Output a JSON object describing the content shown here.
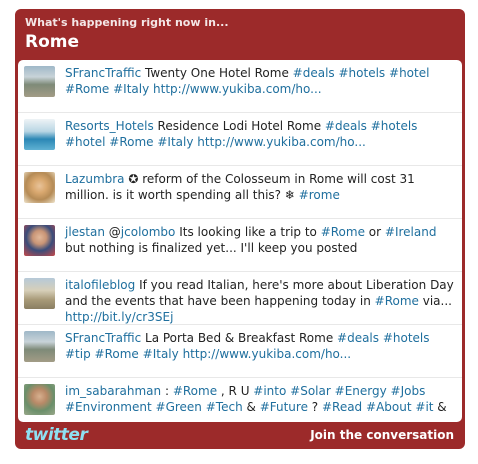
{
  "header": {
    "subtitle": "What's happening right now in...",
    "title": "Rome"
  },
  "colors": {
    "frame": "#9c2a2a",
    "link": "#1f6f9e",
    "logo": "#8ee0f2"
  },
  "tweets": [
    {
      "user": "SFrancTraffic",
      "parts": [
        {
          "t": " Twenty One Hotel Rome "
        },
        {
          "t": "#deals",
          "link": true
        },
        {
          "t": " "
        },
        {
          "t": "#hotels",
          "link": true
        },
        {
          "t": " "
        },
        {
          "t": "#hotel",
          "link": true
        },
        {
          "t": " "
        },
        {
          "t": "#Rome",
          "link": true
        },
        {
          "t": " "
        },
        {
          "t": "#Italy",
          "link": true
        },
        {
          "t": " "
        },
        {
          "t": "http://www.yukiba.com/ho...",
          "link": true
        }
      ],
      "avatar": "city-aerial"
    },
    {
      "user": "Resorts_Hotels",
      "parts": [
        {
          "t": " Residence Lodi Hotel Rome "
        },
        {
          "t": "#deals",
          "link": true
        },
        {
          "t": " "
        },
        {
          "t": "#hotels",
          "link": true
        },
        {
          "t": " "
        },
        {
          "t": "#hotel",
          "link": true
        },
        {
          "t": " "
        },
        {
          "t": "#Rome",
          "link": true
        },
        {
          "t": " "
        },
        {
          "t": "#Italy",
          "link": true
        },
        {
          "t": " "
        },
        {
          "t": "http://www.yukiba.com/ho...",
          "link": true
        }
      ],
      "avatar": "pool"
    },
    {
      "user": "Lazumbra",
      "parts": [
        {
          "t": " ✪ reform of the Colosseum in Rome will cost 31 million. is it worth spending all this? ❄ "
        },
        {
          "t": "#rome",
          "link": true
        }
      ],
      "avatar": "portrait-blonde"
    },
    {
      "user": "jlestan",
      "parts": [
        {
          "t": " @"
        },
        {
          "t": "jcolombo",
          "link": true
        },
        {
          "t": " Its looking like a trip to "
        },
        {
          "t": "#Rome",
          "link": true
        },
        {
          "t": " or "
        },
        {
          "t": "#Ireland",
          "link": true
        },
        {
          "t": " but nothing is finalized yet... I'll keep you posted"
        }
      ],
      "avatar": "portrait-man"
    },
    {
      "user": "italofileblog",
      "parts": [
        {
          "t": " If you read Italian, here's more about Liberation Day and the events that have been happening today in "
        },
        {
          "t": "#Rome",
          "link": true
        },
        {
          "t": " via... "
        },
        {
          "t": "http://bit.ly/cr3SEj",
          "link": true
        }
      ],
      "avatar": "ruins"
    },
    {
      "user": "SFrancTraffic",
      "parts": [
        {
          "t": " La Porta Bed & Breakfast Rome "
        },
        {
          "t": "#deals",
          "link": true
        },
        {
          "t": " "
        },
        {
          "t": "#hotels",
          "link": true
        },
        {
          "t": " "
        },
        {
          "t": "#tip",
          "link": true
        },
        {
          "t": " "
        },
        {
          "t": "#Rome",
          "link": true
        },
        {
          "t": " "
        },
        {
          "t": "#Italy",
          "link": true
        },
        {
          "t": " "
        },
        {
          "t": "http://www.yukiba.com/ho...",
          "link": true
        }
      ],
      "avatar": "city-aerial"
    },
    {
      "user": "im_sabarahman",
      "parts": [
        {
          "t": " : "
        },
        {
          "t": "#Rome",
          "link": true
        },
        {
          "t": " , R U "
        },
        {
          "t": "#into",
          "link": true
        },
        {
          "t": " "
        },
        {
          "t": "#Solar",
          "link": true
        },
        {
          "t": " "
        },
        {
          "t": "#Energy",
          "link": true
        },
        {
          "t": " "
        },
        {
          "t": "#Jobs",
          "link": true
        },
        {
          "t": " "
        },
        {
          "t": "#Environment",
          "link": true
        },
        {
          "t": " "
        },
        {
          "t": "#Green",
          "link": true
        },
        {
          "t": " "
        },
        {
          "t": "#Tech",
          "link": true
        },
        {
          "t": " & "
        },
        {
          "t": "#Future",
          "link": true
        },
        {
          "t": " ? "
        },
        {
          "t": "#Read",
          "link": true
        },
        {
          "t": " "
        },
        {
          "t": "#About",
          "link": true
        },
        {
          "t": " "
        },
        {
          "t": "#it",
          "link": true
        },
        {
          "t": " &"
        }
      ],
      "avatar": "portrait-man2"
    }
  ],
  "footer": {
    "logo": "twitter",
    "join": "Join the conversation"
  }
}
